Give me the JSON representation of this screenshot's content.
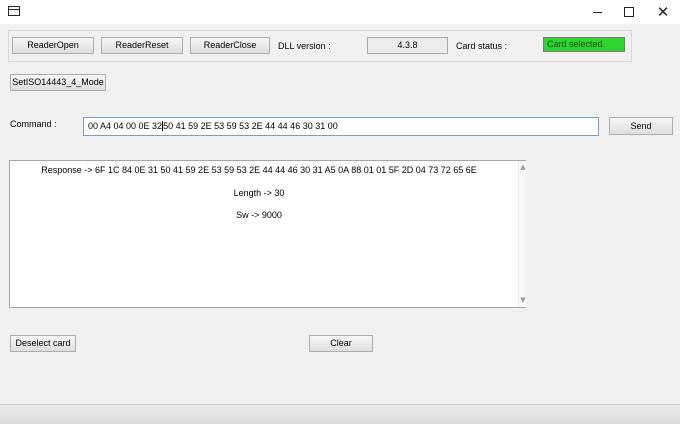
{
  "window": {
    "icons": {
      "app": "app-window-icon",
      "minimize": "minimize-icon",
      "maximize": "maximize-icon",
      "close": "close-icon"
    },
    "close_glyph": "✕"
  },
  "toolbar": {
    "reader_open_label": "ReaderOpen",
    "reader_reset_label": "ReaderReset",
    "reader_close_label": "ReaderClose",
    "dll_version_label": "DLL version :",
    "dll_version_value": "4.3.8",
    "card_status_label": "Card status :",
    "card_status_value": "Card selected."
  },
  "mode": {
    "set_mode_label": "SetISO14443_4_Mode"
  },
  "command": {
    "label": "Command :",
    "value_before_caret": "00 A4 04 00 0E 32",
    "value_after_caret": "50 41 59 2E 53 59 53 2E 44 44 46 30 31 00",
    "send_label": "Send"
  },
  "response": {
    "line1": "Response -> 6F 1C 84 0E 31 50 41 59 2E 53 59 53 2E 44 44 46 30 31 A5 0A 88 01 01 5F 2D 04 73 72 65 6E",
    "line2": "Length -> 30",
    "line3": "Sw -> 9000"
  },
  "actions": {
    "deselect_label": "Deselect card",
    "clear_label": "Clear"
  },
  "colors": {
    "card_status_bg": "#2fd42f",
    "input_border": "#7a9cc6"
  }
}
